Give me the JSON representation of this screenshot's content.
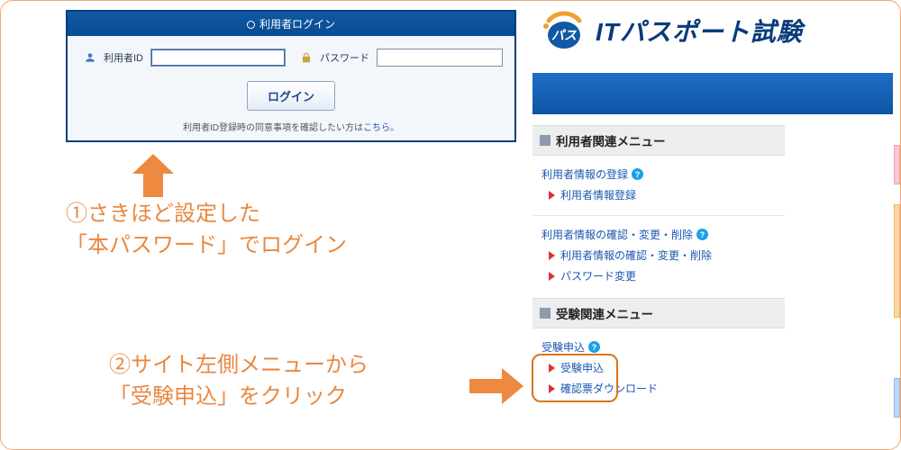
{
  "login": {
    "header": "利用者ログイン",
    "user_label": "利用者ID",
    "pass_label": "パスワード",
    "button": "ログイン",
    "note_pre": "利用者ID登録時の同意事項を確認したい方は",
    "note_link": "こちら",
    "note_post": "。"
  },
  "instruction1_l1": "①さきほど設定した",
  "instruction1_l2": "「本パスワード」でログイン",
  "instruction2_l1": "②サイト左側メニューから",
  "instruction2_l2": "「受験申込」をクリック",
  "site": {
    "logo_text": "パス",
    "title": "ITパスポート試験"
  },
  "menu": {
    "group1_header": "利用者関連メニュー",
    "sec1_title": "利用者情報の登録",
    "sec1_items": [
      "利用者情報登録"
    ],
    "sec2_title": "利用者情報の確認・変更・削除",
    "sec2_items": [
      "利用者情報の確認・変更・削除",
      "パスワード変更"
    ],
    "group2_header": "受験関連メニュー",
    "sec3_title": "受験申込",
    "sec3_items": [
      "受験申込",
      "確認票ダウンロード"
    ]
  }
}
